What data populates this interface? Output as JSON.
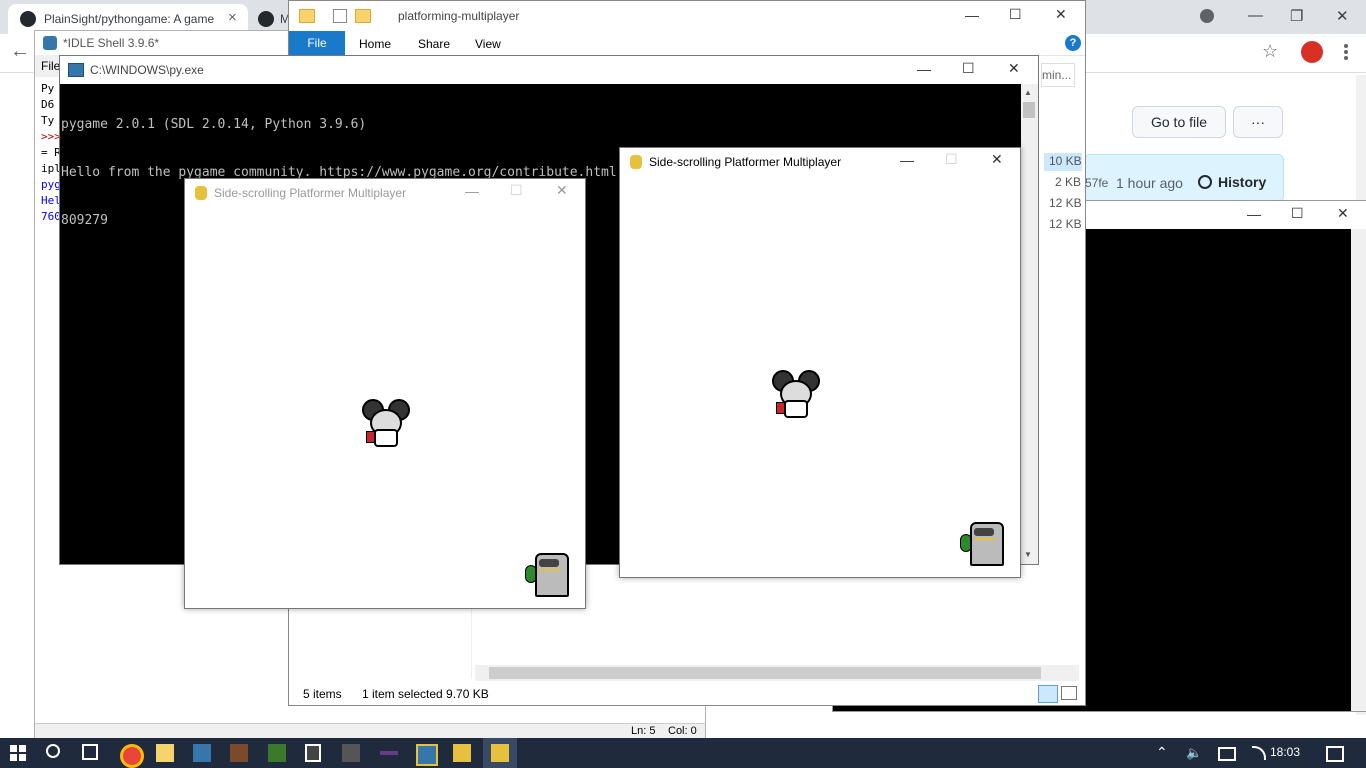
{
  "chrome": {
    "tab1_title": "PlainSight/pythongame: A game",
    "tab1_close": "×",
    "tab2_title": "M",
    "ctrl_restore": "❐",
    "ctrl_min": "—",
    "ctrl_close": "✕",
    "back_glyph": "←",
    "star_glyph": "☆"
  },
  "github": {
    "go_to_file": "Go to file",
    "more": "···",
    "commit_fragment": "57fe",
    "commit_time": "1 hour ago",
    "history": "History",
    "file_sizes": [
      "10 KB",
      "2 KB",
      "12 KB",
      "12 KB"
    ]
  },
  "idle": {
    "title": "*IDLE Shell 3.9.6*",
    "menu_file": "File",
    "lines": [
      "Py",
      "D6",
      "Ty",
      ">>>",
      "= R",
      "ipl",
      "pyg",
      "Hel",
      "760"
    ],
    "status_ln": "Ln: 5",
    "status_col": "Col: 0"
  },
  "explorer": {
    "title": "platforming-multiplayer",
    "ribbon_file": "File",
    "ribbon_home": "Home",
    "ribbon_share": "Share",
    "ribbon_view": "View",
    "search_hint": "min...",
    "status_items": "5 items",
    "status_selected": "1 item selected  9.70 KB"
  },
  "console": {
    "title": "C:\\WINDOWS\\py.exe",
    "lines": [
      "pygame 2.0.1 (SDL 2.0.14, Python 3.9.6)",
      "Hello from the pygame community. https://www.pygame.org/contribute.html",
      "809279"
    ]
  },
  "pygame_left": {
    "title": "Side-scrolling Platformer Multiplayer"
  },
  "pygame_right": {
    "title": "Side-scrolling Platformer Multiplayer"
  },
  "taskbar": {
    "clock": "18:03"
  },
  "colors": {
    "taskbar": "#1f2a3c",
    "explorer_file_tab": "#1979ca",
    "console_bg": "#000000",
    "console_text": "#c0c0c0",
    "idle_prompt": "#c00000",
    "idle_blue": "#0000ff"
  }
}
